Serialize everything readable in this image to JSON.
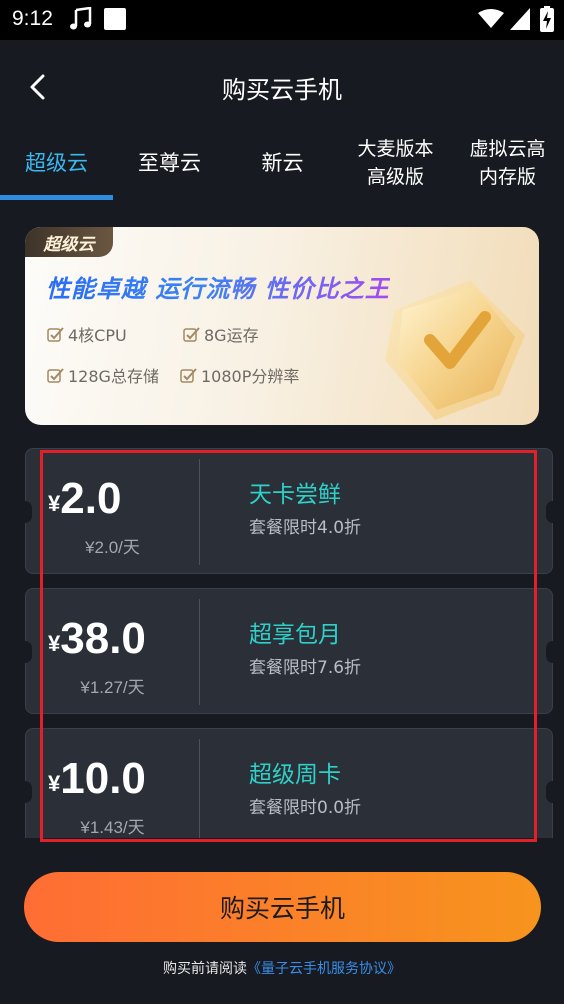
{
  "status_bar": {
    "time": "9:12"
  },
  "header": {
    "title": "购买云手机"
  },
  "tabs": [
    {
      "label": "超级云",
      "active": true
    },
    {
      "label": "至尊云"
    },
    {
      "label": "新云"
    },
    {
      "label": "大麦版本\n高级版"
    },
    {
      "label": "虚拟云高\n内存版"
    }
  ],
  "banner": {
    "badge": "超级云",
    "slogan": "性能卓越 运行流畅 性价比之王",
    "features": [
      "4核CPU",
      "8G运存",
      "128G总存储",
      "1080P分辨率"
    ]
  },
  "plans": [
    {
      "currency": "¥",
      "price": "2.0",
      "per_day": "¥2.0/天",
      "name": "天卡尝鲜",
      "discount": "套餐限时4.0折"
    },
    {
      "currency": "¥",
      "price": "38.0",
      "per_day": "¥1.27/天",
      "name": "超享包月",
      "discount": "套餐限时7.6折"
    },
    {
      "currency": "¥",
      "price": "10.0",
      "per_day": "¥1.43/天",
      "name": "超级周卡",
      "discount": "套餐限时0.0折"
    }
  ],
  "buy_button": {
    "label": "购买云手机"
  },
  "agreement": {
    "prefix": "购买前请阅读",
    "link": "《量子云手机服务协议》"
  },
  "colors": {
    "background": "#171a20",
    "tab_active": "#3ab8f0",
    "plan_name": "#2fd0c8",
    "highlight": "#e3202a",
    "button_start": "#ff6d34",
    "button_end": "#f7941d",
    "link": "#3a8ee8"
  }
}
